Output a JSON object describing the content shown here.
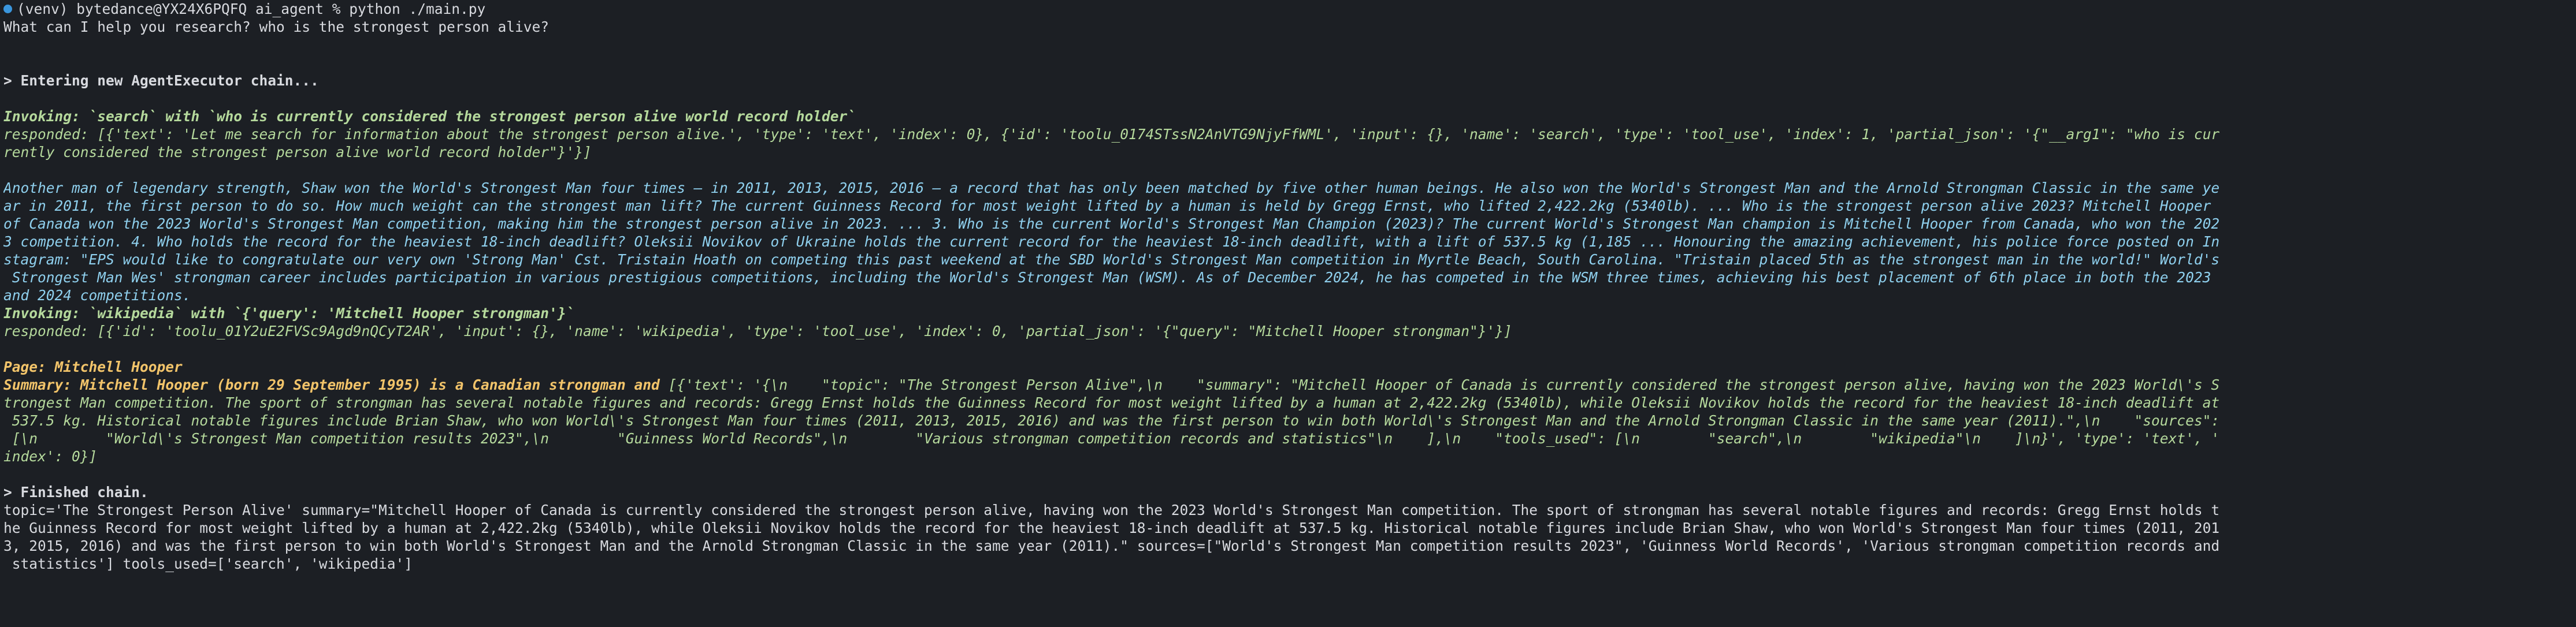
{
  "terminal": {
    "lines": [
      {
        "kind": "prompt",
        "text": "(venv) bytedance@YX24X6PQFQ ai_agent % python ./main.py"
      },
      {
        "kind": "plain",
        "text": "What can I help you research? who is the strongest person alive?"
      },
      {
        "kind": "blank",
        "text": ""
      },
      {
        "kind": "blank",
        "text": ""
      },
      {
        "kind": "bold",
        "text": "> Entering new AgentExecutor chain..."
      },
      {
        "kind": "blank",
        "text": ""
      },
      {
        "kind": "green-b",
        "text": "Invoking: `search` with `who is currently considered the strongest person alive world record holder`"
      },
      {
        "kind": "green",
        "text": "responded: [{'text': 'Let me search for information about the strongest person alive.', 'type': 'text', 'index': 0}, {'id': 'toolu_0174STssN2AnVTG9NjyFfWML', 'input': {}, 'name': 'search', 'type': 'tool_use', 'index': 1, 'partial_json': '{\"__arg1\": \"who is cur"
      },
      {
        "kind": "green",
        "text": "rently considered the strongest person alive world record holder\"}'}]"
      },
      {
        "kind": "blank",
        "text": ""
      },
      {
        "kind": "cyan",
        "text": "Another man of legendary strength, Shaw won the World's Strongest Man four times — in 2011, 2013, 2015, 2016 — a record that has only been matched by five other human beings. He also won the World's Strongest Man and the Arnold Strongman Classic in the same ye"
      },
      {
        "kind": "cyan",
        "text": "ar in 2011, the first person to do so. How much weight can the strongest man lift? The current Guinness Record for most weight lifted by a human is held by Gregg Ernst, who lifted 2,422.2kg (5340lb). ... Who is the strongest person alive 2023? Mitchell Hooper"
      },
      {
        "kind": "cyan",
        "text": "of Canada won the 2023 World's Strongest Man competition, making him the strongest person alive in 2023. ... 3. Who is the current World's Strongest Man Champion (2023)? The current World's Strongest Man champion is Mitchell Hooper from Canada, who won the 202"
      },
      {
        "kind": "cyan",
        "text": "3 competition. 4. Who holds the record for the heaviest 18-inch deadlift? Oleksii Novikov of Ukraine holds the current record for the heaviest 18-inch deadlift, with a lift of 537.5 kg (1,185 ... Honouring the amazing achievement, his police force posted on In"
      },
      {
        "kind": "cyan",
        "text": "stagram: \"EPS would like to congratulate our very own 'Strong Man' Cst. Tristain Hoath on competing this past weekend at the SBD World's Strongest Man competition in Myrtle Beach, South Carolina. \"Tristain placed 5th as the strongest man in the world!\" World's"
      },
      {
        "kind": "cyan",
        "text": " Strongest Man Wes' strongman career includes participation in various prestigious competitions, including the World's Strongest Man (WSM). As of December 2024, he has competed in the WSM three times, achieving his best placement of 6th place in both the 2023"
      },
      {
        "kind": "cyan",
        "text": "and 2024 competitions."
      },
      {
        "kind": "green-b",
        "text": "Invoking: `wikipedia` with `{'query': 'Mitchell Hooper strongman'}`"
      },
      {
        "kind": "green",
        "text": "responded: [{'id': 'toolu_01Y2uE2FVSc9Agd9nQCyT2AR', 'input': {}, 'name': 'wikipedia', 'type': 'tool_use', 'index': 0, 'partial_json': '{\"query\": \"Mitchell Hooper strongman\"}'}]"
      },
      {
        "kind": "blank",
        "text": ""
      },
      {
        "kind": "yellow",
        "text": "Page: Mitchell Hooper"
      },
      {
        "kind": "mixed",
        "parts": [
          {
            "cls": "yellow",
            "text": "Summary: Mitchell Hooper (born 29 September 1995) is a Canadian strongman and "
          },
          {
            "cls": "green",
            "text": "[{'text': '{\\n    \"topic\": \"The Strongest Person Alive\",\\n    \"summary\": \"Mitchell Hooper of Canada is currently considered the strongest person alive, having won the 2023 World\\'s S"
          }
        ]
      },
      {
        "kind": "green",
        "text": "trongest Man competition. The sport of strongman has several notable figures and records: Gregg Ernst holds the Guinness Record for most weight lifted by a human at 2,422.2kg (5340lb), while Oleksii Novikov holds the record for the heaviest 18-inch deadlift at"
      },
      {
        "kind": "green",
        "text": " 537.5 kg. Historical notable figures include Brian Shaw, who won World\\'s Strongest Man four times (2011, 2013, 2015, 2016) and was the first person to win both World\\'s Strongest Man and the Arnold Strongman Classic in the same year (2011).\",\\n    \"sources\":"
      },
      {
        "kind": "green",
        "text": " [\\n        \"World\\'s Strongest Man competition results 2023\",\\n        \"Guinness World Records\",\\n        \"Various strongman competition records and statistics\"\\n    ],\\n    \"tools_used\": [\\n        \"search\",\\n        \"wikipedia\"\\n    ]\\n}', 'type': 'text', '"
      },
      {
        "kind": "green",
        "text": "index': 0}]"
      },
      {
        "kind": "blank",
        "text": ""
      },
      {
        "kind": "bold",
        "text": "> Finished chain."
      },
      {
        "kind": "plain",
        "text": "topic='The Strongest Person Alive' summary=\"Mitchell Hooper of Canada is currently considered the strongest person alive, having won the 2023 World's Strongest Man competition. The sport of strongman has several notable figures and records: Gregg Ernst holds t"
      },
      {
        "kind": "plain",
        "text": "he Guinness Record for most weight lifted by a human at 2,422.2kg (5340lb), while Oleksii Novikov holds the record for the heaviest 18-inch deadlift at 537.5 kg. Historical notable figures include Brian Shaw, who won World's Strongest Man four times (2011, 201"
      },
      {
        "kind": "plain",
        "text": "3, 2015, 2016) and was the first person to win both World's Strongest Man and the Arnold Strongman Classic in the same year (2011).\" sources=[\"World's Strongest Man competition results 2023\", 'Guinness World Records', 'Various strongman competition records and"
      },
      {
        "kind": "plain",
        "text": " statistics'] tools_used=['search', 'wikipedia']"
      }
    ]
  }
}
